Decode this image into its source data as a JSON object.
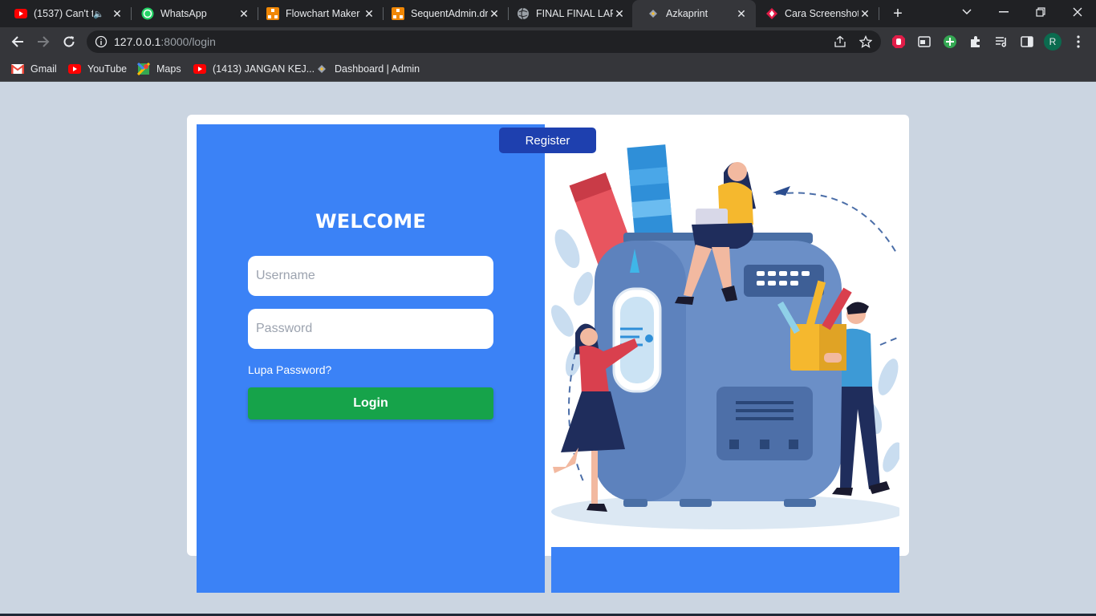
{
  "browser": {
    "tabs": [
      {
        "title": "(1537) Can't t",
        "icon": "youtube-icon"
      },
      {
        "title": "WhatsApp",
        "icon": "whatsapp-icon"
      },
      {
        "title": "Flowchart Maker",
        "icon": "drawio-icon"
      },
      {
        "title": "SequentAdmin.dr",
        "icon": "drawio-icon"
      },
      {
        "title": "FINAL FINAL LAP",
        "icon": "globe-icon"
      },
      {
        "title": "Azkaprint",
        "icon": "site-icon"
      },
      {
        "title": "Cara Screenshot",
        "icon": "screenshot-site-icon"
      }
    ],
    "active_tab": 5,
    "url_host": "127.0.0.1",
    "url_path": ":8000/login",
    "profile_initial": "R",
    "bookmarks": [
      {
        "label": "Gmail",
        "icon": "gmail-icon"
      },
      {
        "label": "YouTube",
        "icon": "youtube-icon"
      },
      {
        "label": "Maps",
        "icon": "maps-icon"
      },
      {
        "label": "(1413) JANGAN KEJ...",
        "icon": "youtube-icon"
      },
      {
        "label": "Dashboard | Admin",
        "icon": "site-icon"
      }
    ]
  },
  "page": {
    "register_label": "Register",
    "welcome_title": "WELCOME",
    "username_placeholder": "Username",
    "password_placeholder": "Password",
    "forgot_label": "Lupa Password?",
    "login_label": "Login"
  },
  "colors": {
    "panel_blue": "#3b82f6",
    "register_blue": "#1e40af",
    "login_green": "#16a34a",
    "page_bg": "#cbd5e1"
  }
}
